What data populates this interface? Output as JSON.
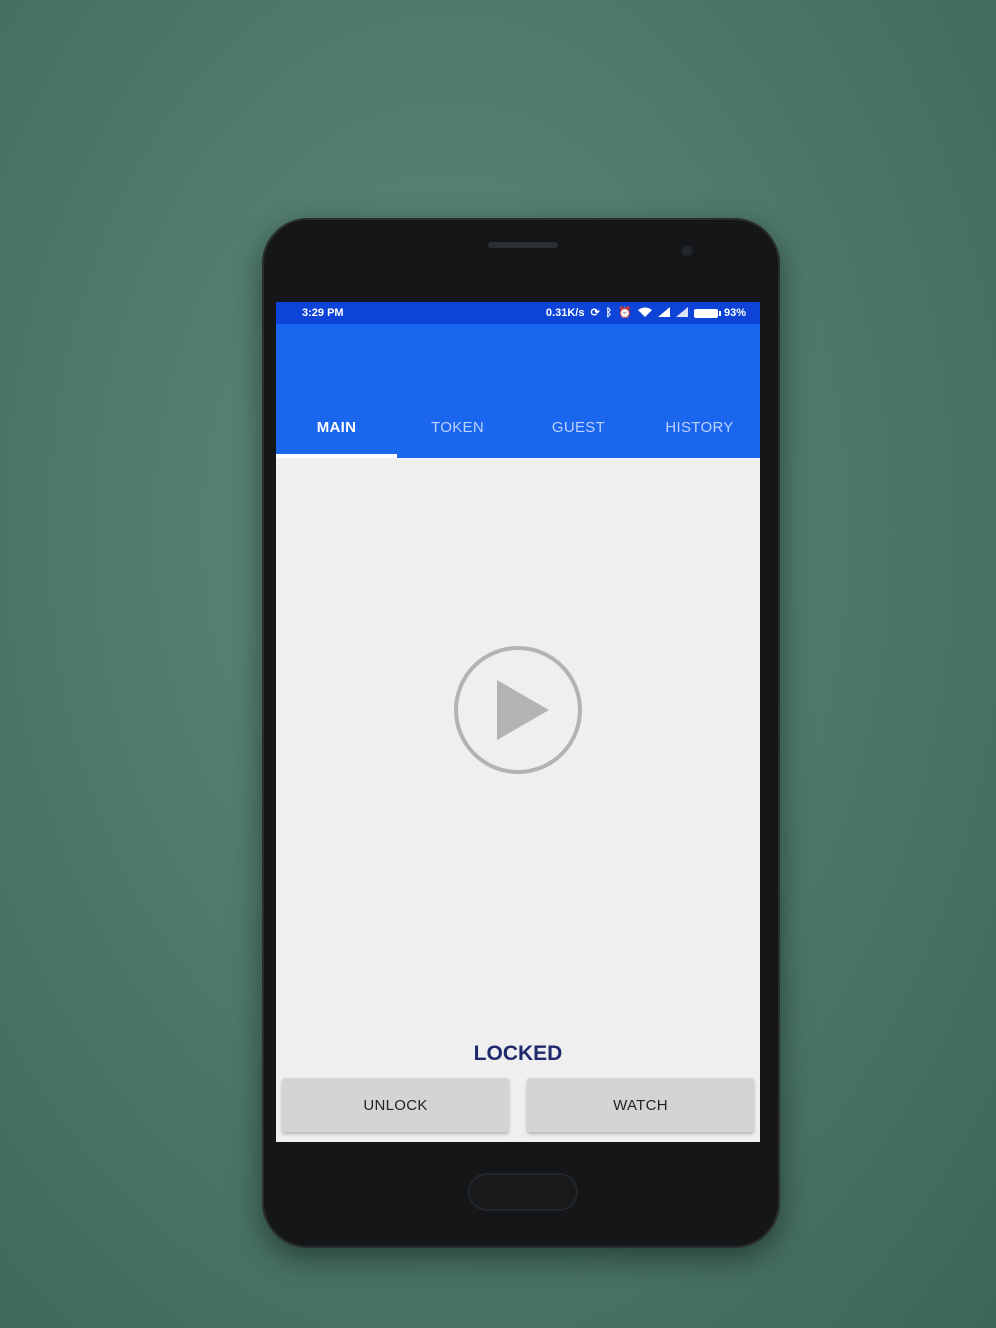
{
  "status_bar": {
    "time": "3:29 PM",
    "net_speed": "0.31K/s",
    "battery": "93%",
    "icons": [
      "sync-icon",
      "bluetooth-icon",
      "alarm-icon",
      "wifi-icon",
      "signal-icon",
      "signal-icon",
      "battery-icon"
    ]
  },
  "tabs": [
    {
      "label": "MAIN",
      "active": true
    },
    {
      "label": "TOKEN",
      "active": false
    },
    {
      "label": "GUEST",
      "active": false
    },
    {
      "label": "HISTORY",
      "active": false
    }
  ],
  "main": {
    "play_icon": "play-icon",
    "lock_status": "LOCKED",
    "unlock_label": "UNLOCK",
    "watch_label": "WATCH"
  },
  "colors": {
    "status_bar": "#0e43d8",
    "app_bar": "#1a66ee",
    "lock_status": "#1f2a6e",
    "button": "#d4d4d6"
  }
}
